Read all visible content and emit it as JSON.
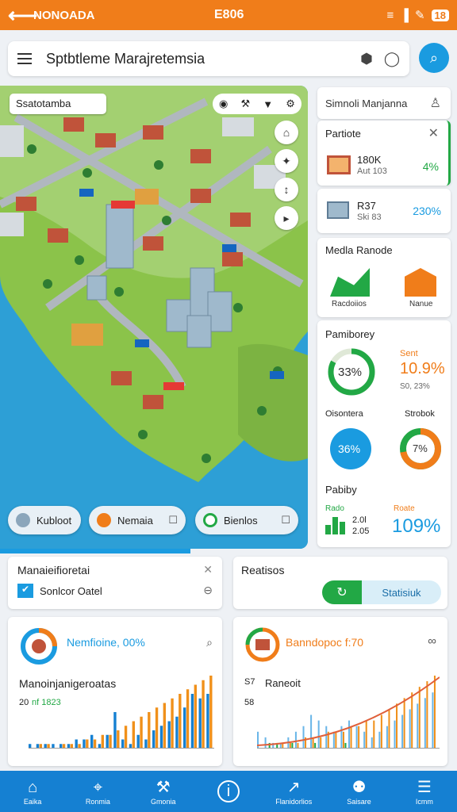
{
  "status": {
    "back": "⟵",
    "carrier": "NONOADA",
    "time": "E806",
    "battery": "18"
  },
  "search": {
    "title": "Sptbtleme Marajretemsia"
  },
  "map": {
    "label": "Ssatotamba",
    "pills": [
      {
        "label": "Kubloot",
        "color": "#8ba6bb"
      },
      {
        "label": "Nemaia",
        "color": "#f07d1a"
      },
      {
        "label": "Bienlos",
        "color": "#22a845"
      }
    ]
  },
  "panel": {
    "header": "Simnoli Manjanna",
    "portfolio": {
      "title": "Partiote",
      "items": [
        {
          "value": "180K",
          "sub": "Aut 103",
          "pct": "4%"
        },
        {
          "value": "R37",
          "sub": "Ski 83",
          "pct": "230%"
        }
      ]
    },
    "media": {
      "title": "Medla Ranode",
      "cap1": "Racdoiios",
      "cap2": "Nanue"
    },
    "stats": {
      "title": "Pamiborey",
      "donut1": {
        "value": "33%",
        "fraction": 0.83
      },
      "sent_label": "Sent",
      "sent_value": "10.9%",
      "sent_sub": "S0, 23%",
      "donut2_label": "Oisontera",
      "donut2": {
        "value": "36%",
        "fraction": 0.36
      },
      "donut3_label": "Strobok",
      "donut3": {
        "value": "7%",
        "fraction": 0.72
      },
      "footer_title": "Pabiby",
      "f_label1": "Rado",
      "f_v1": "2.0l",
      "f_v2": "2.05",
      "f_label2": "Roate",
      "f_big": "109%"
    }
  },
  "cards": {
    "left_top": {
      "title": "Manaieifioretai",
      "row": "Sonlcor Oatel"
    },
    "right_top": {
      "title": "Reatisos",
      "button": "Statisiuk"
    },
    "chart1": {
      "title": "Nemfioine, 00%",
      "subtitle": "Manoinjanigeroatas",
      "legend": "nf 1823",
      "ylabel": "20"
    },
    "chart2": {
      "title": "Banndopoc f:70",
      "subtitle": "Raneoit",
      "y1": "S7",
      "y2": "58"
    }
  },
  "chart_data": [
    {
      "type": "bar",
      "title": "Nemfioine, 00%",
      "series": [
        {
          "color": "#1580d2",
          "values": [
            1,
            1,
            1,
            1,
            1,
            1,
            2,
            2,
            3,
            1,
            3,
            8,
            2,
            1,
            3,
            2,
            4,
            5,
            6,
            7,
            9,
            12,
            11,
            12
          ]
        },
        {
          "color": "#f0901a",
          "values": [
            0,
            1,
            1,
            0,
            1,
            1,
            1,
            2,
            2,
            3,
            3,
            4,
            5,
            6,
            7,
            8,
            9,
            10,
            11,
            12,
            13,
            14,
            15,
            16
          ]
        }
      ]
    },
    {
      "type": "bar",
      "title": "Banndopoc f:70",
      "series": [
        {
          "color": "#6ab6e8",
          "values": [
            3,
            2,
            1,
            1,
            2,
            3,
            4,
            6,
            5,
            4,
            3,
            4,
            5,
            4,
            3,
            2,
            3,
            4,
            5,
            6,
            7,
            8,
            9,
            10
          ]
        },
        {
          "color": "#f0901a",
          "values": [
            0,
            0,
            0,
            1,
            1,
            1,
            2,
            2,
            2,
            3,
            3,
            3,
            4,
            4,
            5,
            5,
            6,
            7,
            8,
            9,
            10,
            11,
            12,
            13
          ]
        },
        {
          "color": "#22a845",
          "values": [
            0,
            1,
            1,
            0,
            1,
            0,
            0,
            1,
            0,
            0,
            0,
            1,
            0,
            0,
            0,
            0,
            0,
            0,
            0,
            0,
            0,
            0,
            0,
            0
          ]
        }
      ]
    }
  ],
  "nav": [
    "Eaika",
    "Ronmia",
    "Gmonia",
    "",
    "Flanidorlios",
    "Saisare",
    "Icmm"
  ]
}
